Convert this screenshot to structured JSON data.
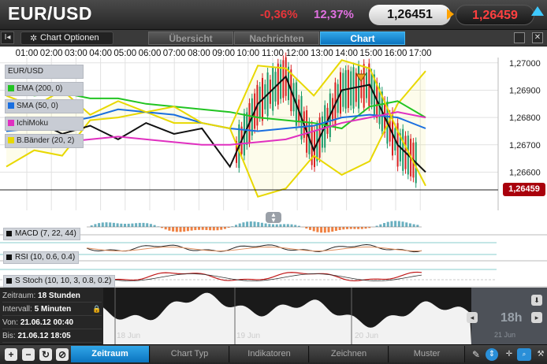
{
  "header": {
    "pair": "EUR/USD",
    "change_abs": "-0,36%",
    "change_pct": "12,37%",
    "bid": "1,26451",
    "ask": "1,26459"
  },
  "tabs": {
    "options_label": "Chart Optionen",
    "overview": "Übersicht",
    "news": "Nachrichten",
    "chart": "Chart"
  },
  "legend": {
    "symbol": "EUR/USD",
    "ema": "EMA (200, 0)",
    "sma": "SMA (50, 0)",
    "ichimoku": "IchiMoku",
    "bollinger": "B.Bänder (20, 2)"
  },
  "colors": {
    "ema": "#22c422",
    "sma": "#1a6fe0",
    "ichimoku": "#e030c0",
    "bollinger": "#e8d800",
    "up": "#1a9a6a",
    "down": "#d82020",
    "price_badge": "#a9000c"
  },
  "indicators": {
    "macd": "MACD (7, 22, 44)",
    "rsi": "RSI (10, 0.6, 0.4)",
    "stoch": "S Stoch (10, 10, 3, 0.8, 0.2)"
  },
  "current_price_label": "1,26459",
  "navigator": {
    "zeitraum_label": "Zeitraum:",
    "zeitraum_value": "18 Stunden",
    "intervall_label": "Intervall:",
    "intervall_value": "5 Minuten",
    "von_label": "Von:",
    "von_value": "21.06.12 00:40",
    "bis_label": "Bis:",
    "bis_value": "21.06.12 18:05",
    "time_big": "18h",
    "date_right": "21 Jun",
    "dates": [
      "18 Jun",
      "19 Jun",
      "20 Jun"
    ]
  },
  "toolbar": {
    "zeitraum": "Zeitraum",
    "charttyp": "Chart Typ",
    "indikatoren": "Indikatoren",
    "zeichnen": "Zeichnen",
    "muster": "Muster"
  },
  "chart_data": {
    "type": "line",
    "x_labels": [
      "01:00",
      "02:00",
      "03:00",
      "04:00",
      "05:00",
      "06:00",
      "07:00",
      "08:00",
      "09:00",
      "10:00",
      "11:00",
      "12:00",
      "13:00",
      "14:00",
      "15:00",
      "16:00",
      "17:00"
    ],
    "y_ticks": [
      "1,27000",
      "1,26900",
      "1,26800",
      "1,26700",
      "1,26600"
    ],
    "y_values": [
      1.27,
      1.269,
      1.268,
      1.267,
      1.266
    ],
    "ylim": [
      1.2646,
      1.2706
    ],
    "current_price": 1.26459,
    "series": [
      {
        "name": "EUR/USD",
        "values": [
          1.2675,
          1.2679,
          1.2674,
          1.2677,
          1.2672,
          1.2678,
          1.2674,
          1.2676,
          1.2662,
          1.2685,
          1.2695,
          1.2668,
          1.269,
          1.2692,
          1.267,
          1.266
        ]
      },
      {
        "name": "EMA (200, 0)",
        "values": [
          1.2691,
          1.2688,
          1.2689,
          1.2687,
          1.2687,
          1.2685,
          1.2684,
          1.2683,
          1.2682,
          1.268,
          1.2679,
          1.2678,
          1.2676,
          1.2684,
          1.2686,
          1.268
        ]
      },
      {
        "name": "SMA (50, 0)",
        "values": [
          1.2675,
          1.2676,
          1.2678,
          1.268,
          1.2683,
          1.2682,
          1.2681,
          1.2678,
          1.2676,
          1.2675,
          1.2676,
          1.2677,
          1.268,
          1.2681,
          1.268,
          1.2676
        ]
      },
      {
        "name": "IchiMoku",
        "values": [
          1.2672,
          1.2673,
          1.2671,
          1.2672,
          1.2673,
          1.2672,
          1.2671,
          1.267,
          1.267,
          1.2671,
          1.2672,
          1.2675,
          1.2678,
          1.268,
          1.2682,
          1.268
        ]
      },
      {
        "name": "B.Bänder (20, 2)",
        "values": [
          1.2688,
          1.2684,
          1.269,
          1.2681,
          1.2686,
          1.2682,
          1.2684,
          1.2678,
          1.2676,
          1.2699,
          1.2698,
          1.2688,
          1.2701,
          1.2698,
          1.2675,
          1.2655
        ]
      }
    ]
  }
}
